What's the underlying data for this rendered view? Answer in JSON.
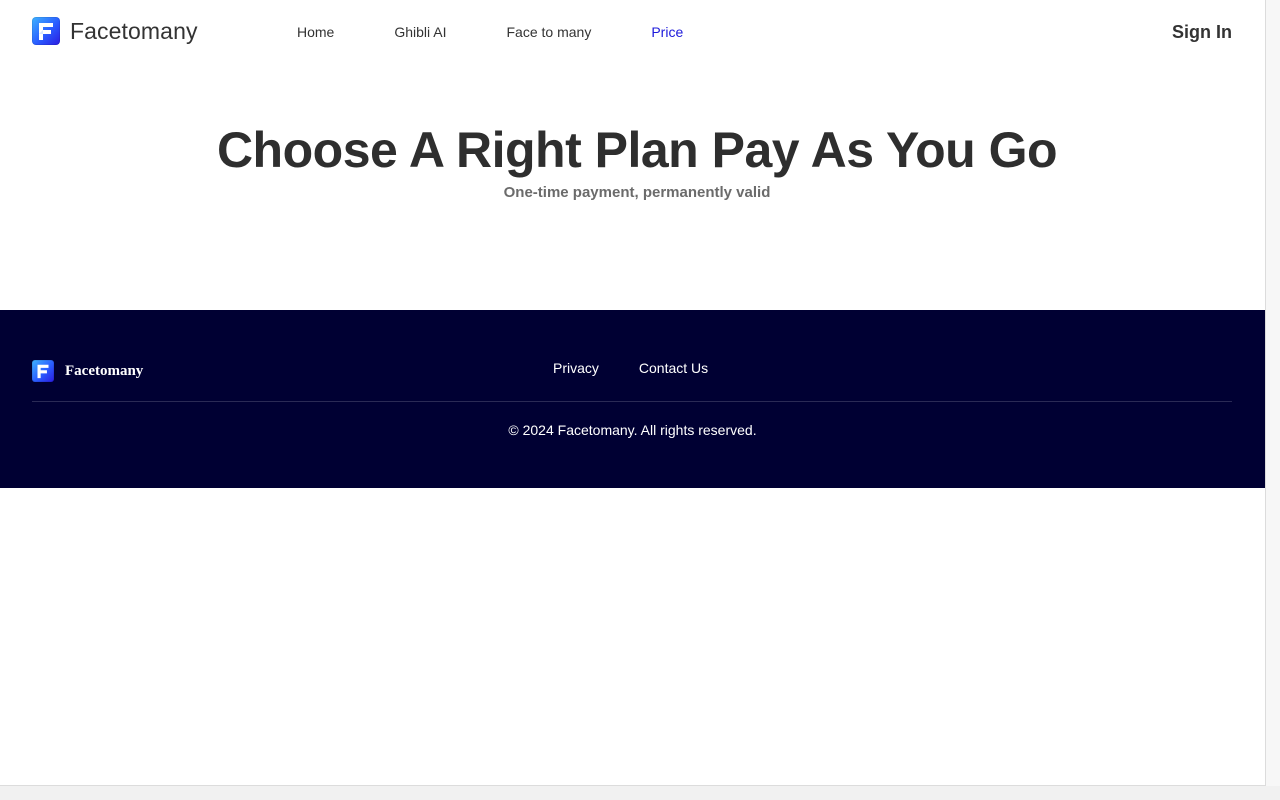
{
  "header": {
    "brand_name": "Facetomany",
    "logo_icon": "facetomany-logo-icon",
    "nav": [
      {
        "label": "Home",
        "active": false
      },
      {
        "label": "Ghibli AI",
        "active": false
      },
      {
        "label": "Face to many",
        "active": false
      },
      {
        "label": "Price",
        "active": true
      }
    ],
    "sign_in_label": "Sign In"
  },
  "hero": {
    "title": "Choose A Right Plan Pay As You Go",
    "subtitle": "One-time payment,  permanently valid"
  },
  "footer": {
    "brand_name": "Facetomany",
    "links": [
      {
        "label": "Privacy"
      },
      {
        "label": "Contact Us"
      }
    ],
    "copyright": "© 2024 Facetomany. All rights reserved."
  },
  "colors": {
    "accent": "#1d1adb",
    "footer_bg": "#000033",
    "text_dark": "#333333",
    "text_muted": "#6b6b6b"
  }
}
